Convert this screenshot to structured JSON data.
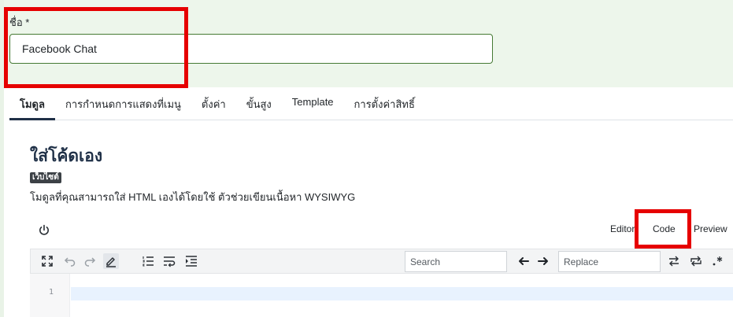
{
  "form": {
    "title_label": "ชื่อ *",
    "title_value": "Facebook Chat"
  },
  "tabs": [
    {
      "label": "โมดูล",
      "active": true
    },
    {
      "label": "การกำหนดการแสดงที่เมนู",
      "active": false
    },
    {
      "label": "ตั้งค่า",
      "active": false
    },
    {
      "label": "ขั้นสูง",
      "active": false
    },
    {
      "label": "Template",
      "active": false
    },
    {
      "label": "การตั้งค่าสิทธิ์",
      "active": false
    }
  ],
  "module": {
    "title": "ใส่โค้ดเอง",
    "badge": "เว็บไซต์",
    "description": "โมดูลที่คุณสามารถใส่ HTML เองได้โดยใช้ ตัวช่วยเขียนเนื้อหา WYSIWYG"
  },
  "editor": {
    "modes": {
      "editor": "Editor",
      "code": "Code",
      "preview": "Preview"
    },
    "active_mode": "Code",
    "search_placeholder": "Search",
    "replace_placeholder": "Replace",
    "line_number": "1",
    "toolbar_icons": [
      "fullscreen-icon",
      "undo-icon",
      "redo-icon",
      "highlight-pen-icon",
      "ordered-list-icon",
      "wrap-lines-icon",
      "indent-icon",
      "find-previous-icon",
      "find-next-icon",
      "replace-icon",
      "replace-all-icon",
      "regex-icon"
    ]
  },
  "colors": {
    "accent": "#467a34",
    "highlight": "#e60000",
    "panel_bg": "#edf6eb",
    "heading": "#1f3047"
  }
}
